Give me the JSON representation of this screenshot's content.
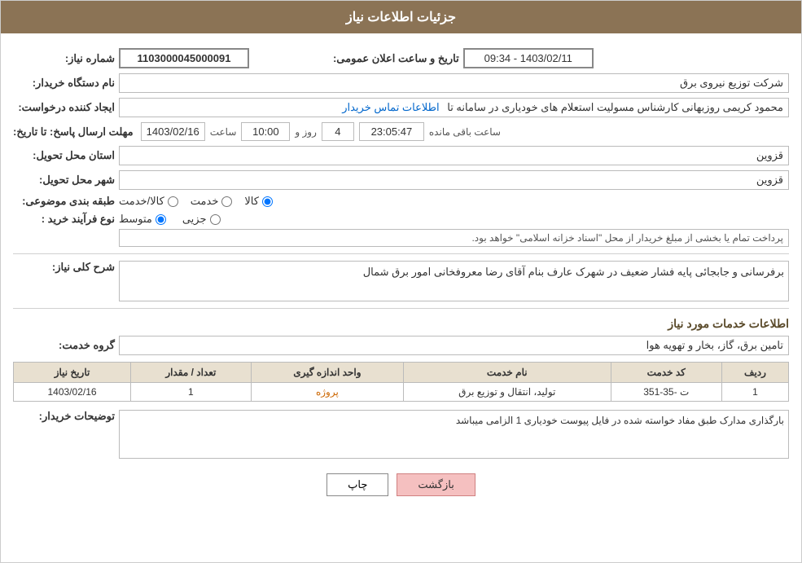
{
  "header": {
    "title": "جزئیات اطلاعات نیاز"
  },
  "fields": {
    "need_number_label": "شماره نیاز:",
    "need_number_value": "1103000045000091",
    "buyer_org_label": "نام دستگاه خریدار:",
    "buyer_org_value": "شرکت توزیع نیروی برق",
    "creator_label": "ایجاد کننده درخواست:",
    "creator_value": "محمود کریمی روزبهانی کارشناس  مسولیت استعلام های خودیاری در سامانه تا",
    "creator_link": "اطلاعات تماس خریدار",
    "deadline_label": "مهلت ارسال پاسخ: تا تاریخ:",
    "deadline_date": "1403/02/16",
    "deadline_time_label": "ساعت",
    "deadline_time": "10:00",
    "deadline_day_label": "روز و",
    "deadline_days": "4",
    "deadline_remaining_label": "ساعت باقی مانده",
    "deadline_remaining": "23:05:47",
    "delivery_province_label": "استان محل تحویل:",
    "delivery_province_value": "قزوین",
    "delivery_city_label": "شهر محل تحویل:",
    "delivery_city_value": "قزوین",
    "category_label": "طبقه بندی موضوعی:",
    "category_options": [
      "کالا",
      "خدمت",
      "کالا/خدمت"
    ],
    "category_selected": "کالا",
    "process_type_label": "نوع فرآیند خرید :",
    "process_options": [
      "جزیی",
      "متوسط"
    ],
    "process_selected": "متوسط",
    "process_note": "پرداخت تمام یا بخشی از مبلغ خریدار از محل \"اسناد خزانه اسلامی\" خواهد بود.",
    "description_label": "شرح کلی نیاز:",
    "description_value": "برفرسانی و جابجائی پایه فشار ضعیف در شهرک عارف بنام آقای رضا معروفخانی امور برق شمال",
    "announcement_label": "تاریخ و ساعت اعلان عمومی:",
    "announcement_value": "1403/02/11 - 09:34"
  },
  "services": {
    "section_title": "اطلاعات خدمات مورد نیاز",
    "service_group_label": "گروه خدمت:",
    "service_group_value": "تامین برق، گاز، بخار و تهویه هوا",
    "table": {
      "columns": [
        "ردیف",
        "کد خدمت",
        "نام خدمت",
        "واحد اندازه گیری",
        "تعداد / مقدار",
        "تاریخ نیاز"
      ],
      "rows": [
        {
          "row_num": "1",
          "service_code": "ت -35-351",
          "service_name": "تولید، انتقال و توزیع برق",
          "unit": "پروژه",
          "quantity": "1",
          "date": "1403/02/16"
        }
      ]
    }
  },
  "buyer_notes": {
    "label": "توضیحات خریدار:",
    "value": "بارگذاری مدارک طبق مفاد خواسته شده در فایل پیوست خودیاری 1 الزامی میباشد"
  },
  "buttons": {
    "print": "چاپ",
    "back": "بازگشت"
  }
}
